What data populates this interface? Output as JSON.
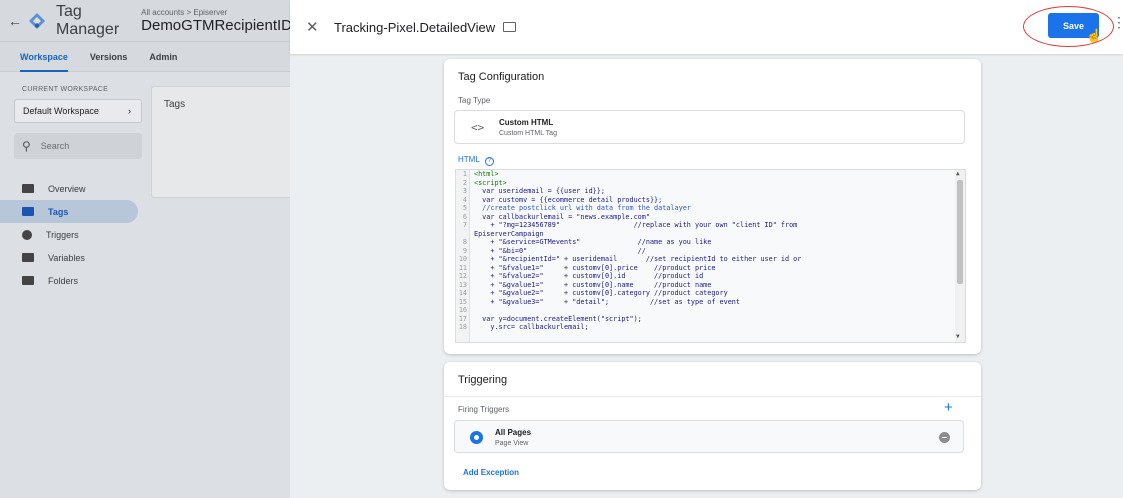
{
  "left": {
    "app_title": "Tag Manager",
    "breadcrumb": "All accounts > Episerver",
    "container_name": "DemoGTMRecipientID",
    "tabs": [
      {
        "label": "Workspace"
      },
      {
        "label": "Versions"
      },
      {
        "label": "Admin"
      }
    ],
    "workspace_label": "CURRENT WORKSPACE",
    "workspace_value": "Default Workspace",
    "search_placeholder": "Search",
    "nav": [
      {
        "label": "Overview"
      },
      {
        "label": "Tags"
      },
      {
        "label": "Triggers"
      },
      {
        "label": "Variables"
      },
      {
        "label": "Folders"
      }
    ],
    "tags_card_title": "Tags"
  },
  "panel": {
    "title": "Tracking-Pixel.DetailedView",
    "save_label": "Save",
    "config": {
      "title": "Tag Configuration",
      "type_label": "Tag Type",
      "type_name": "Custom HTML",
      "type_desc": "Custom HTML Tag",
      "html_label": "HTML",
      "code_lines": [
        {
          "n": "1",
          "t": "<html>"
        },
        {
          "n": "2",
          "t": "<script>"
        },
        {
          "n": "3",
          "t": "  var useridemail = {{user id}};"
        },
        {
          "n": "4",
          "t": "  var customv = {{ecommerce detail products}};"
        },
        {
          "n": "5",
          "t": "  //create postclick url with data from the datalayer"
        },
        {
          "n": "6",
          "t": "  var callbackurlemail = \"news.example.com\""
        },
        {
          "n": "7",
          "t": "    + \"?mg=123456789\"                  //replace with your own \"client ID\" from"
        },
        {
          "n": "",
          "t": "EpiserverCampaign"
        },
        {
          "n": "8",
          "t": "    + \"&service=GTMevents\"              //name as you like"
        },
        {
          "n": "9",
          "t": "    + \"&bi=0\"                           //"
        },
        {
          "n": "10",
          "t": "    + \"&recipientId=\" + useridemail       //set recipientId to either user id or"
        },
        {
          "n": "11",
          "t": "    + \"&fvalue1=\"     + customv[0].price    //product price"
        },
        {
          "n": "12",
          "t": "    + \"&fvalue2=\"     + customv[0].id       //product id"
        },
        {
          "n": "13",
          "t": "    + \"&gvalue1=\"     + customv[0].name     //product name"
        },
        {
          "n": "14",
          "t": "    + \"&gvalue2=\"     + customv[0].category //product category"
        },
        {
          "n": "15",
          "t": "    + \"&gvalue3=\"     + \"detail\";          //set as type of event"
        },
        {
          "n": "16",
          "t": ""
        },
        {
          "n": "17",
          "t": "  var y=document.createElement(\"script\");"
        },
        {
          "n": "18",
          "t": "    y.src= callbackurlemail;"
        }
      ]
    },
    "triggering": {
      "title": "Triggering",
      "firing_label": "Firing Triggers",
      "trigger_name": "All Pages",
      "trigger_type": "Page View",
      "add_exception": "Add Exception"
    }
  }
}
